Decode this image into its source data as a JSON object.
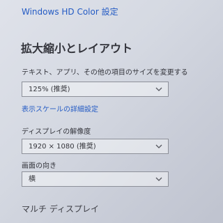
{
  "header": {
    "hd_color_link": "Windows HD Color 設定"
  },
  "scale_layout": {
    "title": "拡大縮小とレイアウト",
    "scale_label": "テキスト、アプリ、その他の項目のサイズを変更する",
    "scale_value": "125% (推奨)",
    "advanced_link": "表示スケールの詳細設定",
    "resolution_label": "ディスプレイの解像度",
    "resolution_value": "1920 × 1080 (推奨)",
    "orientation_label": "画面の向き",
    "orientation_value": "横"
  },
  "multi_display": {
    "title": "マルチ ディスプレイ"
  },
  "icons": {
    "dropdown": "chevron-down-icon"
  }
}
